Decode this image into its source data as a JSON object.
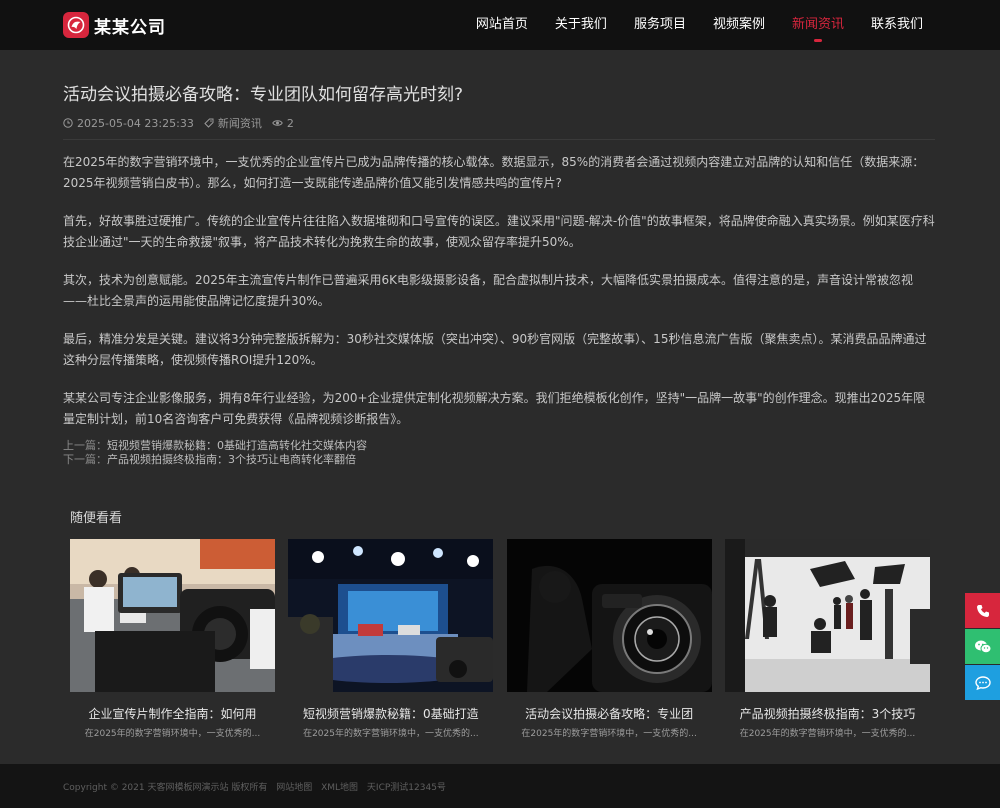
{
  "header": {
    "logo_text": "某某公司",
    "nav": [
      {
        "label": "网站首页"
      },
      {
        "label": "关于我们"
      },
      {
        "label": "服务项目"
      },
      {
        "label": "视频案例"
      },
      {
        "label": "新闻资讯",
        "active": true
      },
      {
        "label": "联系我们"
      }
    ]
  },
  "article": {
    "title": "活动会议拍摄必备攻略：专业团队如何留存高光时刻?",
    "date": "2025-05-04 23:25:33",
    "category": "新闻资讯",
    "views": "2",
    "paragraphs": [
      "在2025年的数字营销环境中，一支优秀的企业宣传片已成为品牌传播的核心载体。数据显示，85%的消费者会通过视频内容建立对品牌的认知和信任（数据来源：2025年视频营销白皮书）。那么，如何打造一支既能传递品牌价值又能引发情感共鸣的宣传片?",
      "首先，好故事胜过硬推广。传统的企业宣传片往往陷入数据堆砌和口号宣传的误区。建议采用\"问题-解决-价值\"的故事框架，将品牌使命融入真实场景。例如某医疗科技企业通过\"一天的生命救援\"叙事，将产品技术转化为挽救生命的故事，使观众留存率提升50%。",
      "其次，技术为创意赋能。2025年主流宣传片制作已普遍采用6K电影级摄影设备，配合虚拟制片技术，大幅降低实景拍摄成本。值得注意的是，声音设计常被忽视——杜比全景声的运用能使品牌记忆度提升30%。",
      "最后，精准分发是关键。建议将3分钟完整版拆解为：30秒社交媒体版（突出冲突）、90秒官网版（完整故事）、15秒信息流广告版（聚焦卖点）。某消费品品牌通过这种分层传播策略，使视频传播ROI提升120%。",
      "某某公司专注企业影像服务，拥有8年行业经验，为200+企业提供定制化视频解决方案。我们拒绝模板化创作，坚持\"一品牌一故事\"的创作理念。现推出2025年限量定制计划，前10名咨询客户可免费获得《品牌视频诊断报告》。"
    ],
    "prev_label": "上一篇：",
    "prev_title": "短视频营销爆款秘籍：0基础打造高转化社交媒体内容",
    "next_label": "下一篇：",
    "next_title": "产品视频拍摄终极指南：3个技巧让电商转化率翻倍"
  },
  "related": {
    "heading": "随便看看",
    "items": [
      {
        "title": "企业宣传片制作全指南：如何用",
        "desc": "在2025年的数字营销环境中，一支优秀的..."
      },
      {
        "title": "短视频营销爆款秘籍：0基础打造",
        "desc": "在2025年的数字营销环境中，一支优秀的..."
      },
      {
        "title": "活动会议拍摄必备攻略：专业团",
        "desc": "在2025年的数字营销环境中，一支优秀的..."
      },
      {
        "title": "产品视频拍摄终极指南：3个技巧",
        "desc": "在2025年的数字营销环境中，一支优秀的..."
      }
    ]
  },
  "footer": {
    "copyright": "Copyright © 2021 天客网模板网演示站 版权所有",
    "sitemap": "网站地图",
    "xml_sitemap": "XML地图",
    "icp": "天ICP测试12345号"
  },
  "side_tools": [
    {
      "icon": "phone-icon",
      "color": "#d7263d"
    },
    {
      "icon": "wechat-icon",
      "color": "#2fbf71"
    },
    {
      "icon": "chat-icon",
      "color": "#1e9fe0"
    }
  ],
  "colors": {
    "accent": "#d7263d",
    "background": "#2b2b2b",
    "header": "#111111"
  }
}
